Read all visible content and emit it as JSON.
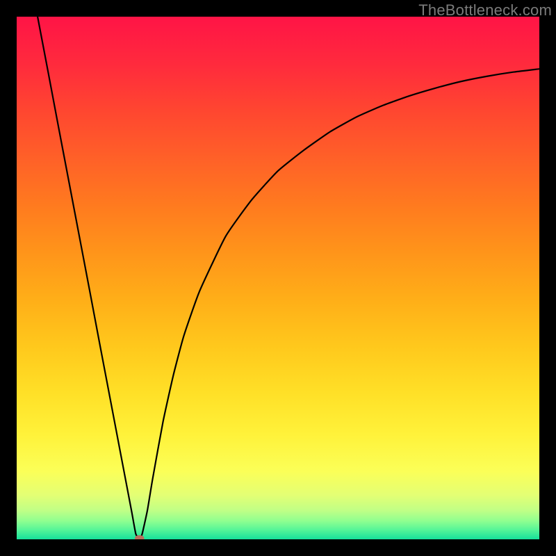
{
  "watermark": "TheBottleneck.com",
  "chart_data": {
    "type": "line",
    "title": "",
    "xlabel": "",
    "ylabel": "",
    "xlim": [
      0,
      1
    ],
    "ylim": [
      0,
      1
    ],
    "axis_ticks_visible": false,
    "series": [
      {
        "name": "curve",
        "color": "#000000",
        "x": [
          0.04,
          0.06,
          0.08,
          0.1,
          0.12,
          0.14,
          0.16,
          0.18,
          0.2,
          0.22,
          0.228,
          0.235,
          0.24,
          0.25,
          0.26,
          0.28,
          0.3,
          0.32,
          0.35,
          0.4,
          0.45,
          0.5,
          0.55,
          0.6,
          0.65,
          0.7,
          0.75,
          0.8,
          0.85,
          0.9,
          0.95,
          1.0
        ],
        "y": [
          1.0,
          0.895,
          0.789,
          0.684,
          0.579,
          0.474,
          0.368,
          0.263,
          0.158,
          0.053,
          0.01,
          0.002,
          0.01,
          0.055,
          0.115,
          0.225,
          0.315,
          0.39,
          0.475,
          0.58,
          0.65,
          0.705,
          0.745,
          0.78,
          0.808,
          0.83,
          0.848,
          0.863,
          0.876,
          0.886,
          0.894,
          0.9
        ]
      }
    ],
    "marker": {
      "name": "min-point",
      "x": 0.235,
      "y": 0.002,
      "rx": 0.009,
      "ry": 0.006,
      "fill": "#b96e5b"
    },
    "background_gradient": {
      "stops": [
        {
          "offset": 0.0,
          "color": "#ff1446"
        },
        {
          "offset": 0.09,
          "color": "#ff2a3d"
        },
        {
          "offset": 0.18,
          "color": "#ff4630"
        },
        {
          "offset": 0.27,
          "color": "#ff6028"
        },
        {
          "offset": 0.36,
          "color": "#ff7a1f"
        },
        {
          "offset": 0.45,
          "color": "#ff941a"
        },
        {
          "offset": 0.54,
          "color": "#ffae18"
        },
        {
          "offset": 0.63,
          "color": "#ffc81c"
        },
        {
          "offset": 0.72,
          "color": "#ffe027"
        },
        {
          "offset": 0.8,
          "color": "#fff23a"
        },
        {
          "offset": 0.87,
          "color": "#fbff58"
        },
        {
          "offset": 0.915,
          "color": "#e4ff74"
        },
        {
          "offset": 0.945,
          "color": "#c0ff86"
        },
        {
          "offset": 0.965,
          "color": "#8fff90"
        },
        {
          "offset": 0.982,
          "color": "#55f598"
        },
        {
          "offset": 1.0,
          "color": "#16e19b"
        }
      ]
    }
  }
}
